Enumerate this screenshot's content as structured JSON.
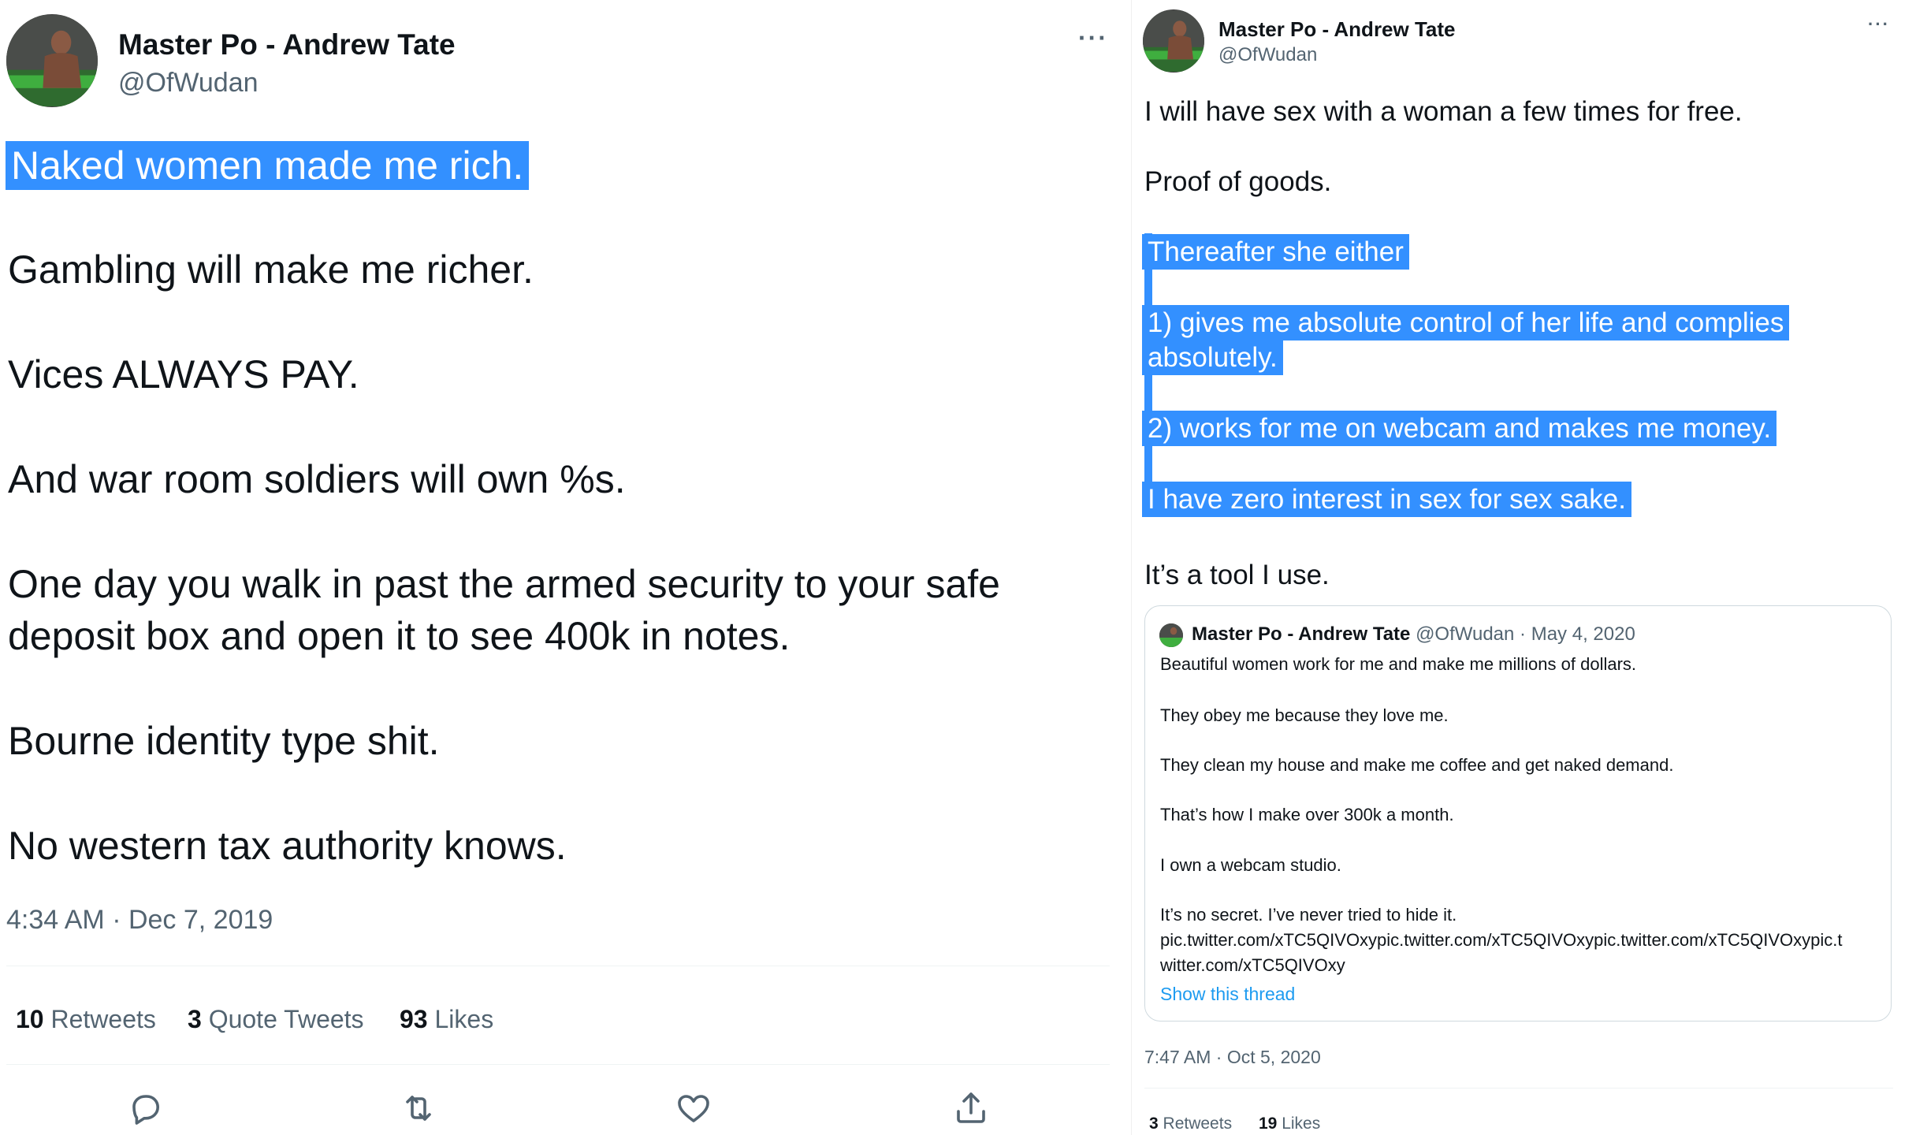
{
  "left": {
    "author": {
      "name": "Master Po - Andrew Tate",
      "handle": "@OfWudan"
    },
    "more": "···",
    "lines": {
      "l1": "Naked women made me rich.",
      "l2": "Gambling will make me richer.",
      "l3": "Vices ALWAYS PAY.",
      "l4": "And war room soldiers will own %s.",
      "l5a": "One day you walk in past the armed security to your safe",
      "l5b": "deposit box and open it to see 400k in notes.",
      "l6": "Bourne identity type shit.",
      "l7": "No western tax authority knows."
    },
    "timestamp": "4:34 AM · Dec 7, 2019",
    "stats": {
      "retweets_count": "10",
      "retweets_label": "Retweets",
      "quotes_count": "3",
      "quotes_label": "Quote Tweets",
      "likes_count": "93",
      "likes_label": "Likes"
    }
  },
  "right": {
    "author": {
      "name": "Master Po - Andrew Tate",
      "handle": "@OfWudan"
    },
    "more": "···",
    "lines": {
      "l1": "I will have sex with a woman a few times for free.",
      "l2": "Proof of goods.",
      "l3": "Thereafter she either",
      "l4a": "1) gives me absolute control of her life and complies",
      "l4b": "absolutely.",
      "l5": "2) works for me on webcam and makes me money.",
      "l6": "I have zero interest in sex for sex sake.",
      "l7": "It’s a tool I use."
    },
    "quote": {
      "name": "Master Po - Andrew Tate",
      "handle": "@OfWudan",
      "date": "· May 4, 2020",
      "lines": {
        "q1": "Beautiful women work for me and make me millions of dollars.",
        "q2": "They obey me because they love me.",
        "q3": "They clean my house and make me coffee and get naked demand.",
        "q4": "That’s how I make over 300k a month.",
        "q5": "I own a webcam studio.",
        "q6": "It’s no secret. I’ve never tried to hide it.",
        "q7": "pic.twitter.com/xTC5QIVOxypic.twitter.com/xTC5QIVOxypic.twitter.com/xTC5QIVOxypic.t",
        "q8": "witter.com/xTC5QIVOxy"
      },
      "show_thread": "Show this thread"
    },
    "timestamp": "7:47 AM · Oct 5, 2020",
    "stats": {
      "retweets_count": "3",
      "retweets_label": "Retweets",
      "likes_count": "19",
      "likes_label": "Likes"
    }
  },
  "icons": {
    "reply": "reply-icon",
    "retweet": "retweet-icon",
    "like": "heart-icon",
    "share": "share-icon"
  },
  "colors": {
    "selection": "#3390ff",
    "link": "#1d9bf0",
    "secondary_text": "#536471",
    "primary_text": "#0f1419"
  }
}
